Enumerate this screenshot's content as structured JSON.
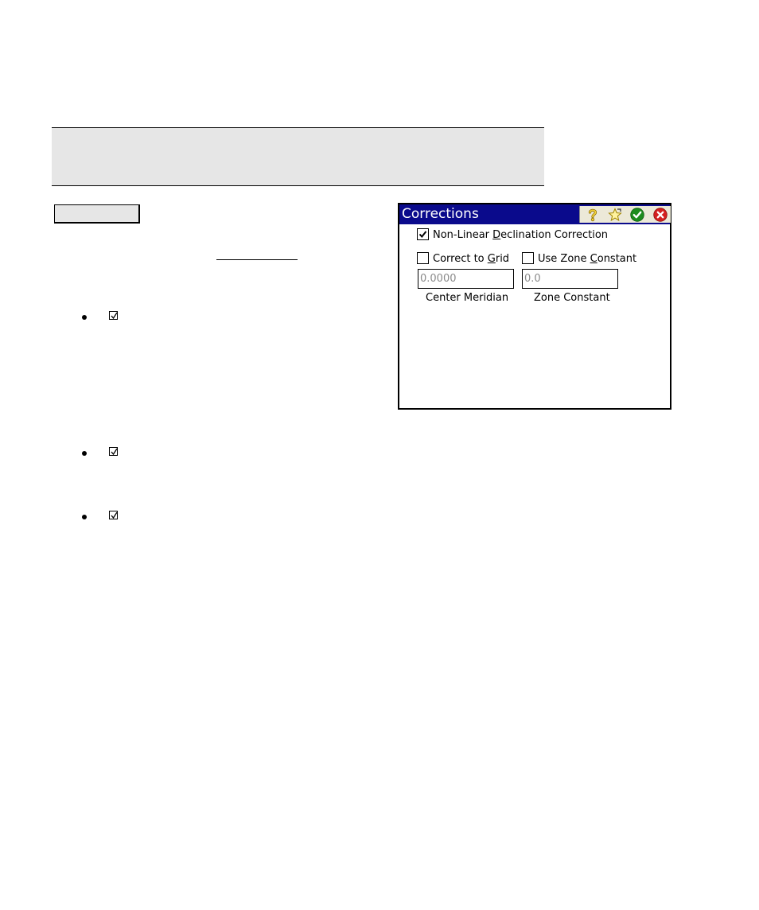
{
  "dialog": {
    "title": "Corrections",
    "toolbar_icons": [
      "help-icon",
      "favorite-star-icon",
      "ok-check-icon",
      "close-icon"
    ],
    "nonlinear": {
      "pre": "Non-Linear ",
      "key": "D",
      "post": "eclination Correction",
      "checked": true
    },
    "grid": {
      "pre": "Correct to ",
      "key": "G",
      "post": "rid",
      "checked": false
    },
    "zone": {
      "pre": "Use Zone ",
      "key": "C",
      "post": "onstant",
      "checked": false
    },
    "center_meridian": {
      "value": "0.0000",
      "label": "Center Meridian"
    },
    "zone_constant": {
      "value": "0.0",
      "label": "Zone Constant"
    }
  },
  "colors": {
    "titlebar": "#0a0a8c",
    "header_band": "#e6e6e6",
    "ok_green": "#1e8c1e",
    "close_red": "#d42020"
  }
}
